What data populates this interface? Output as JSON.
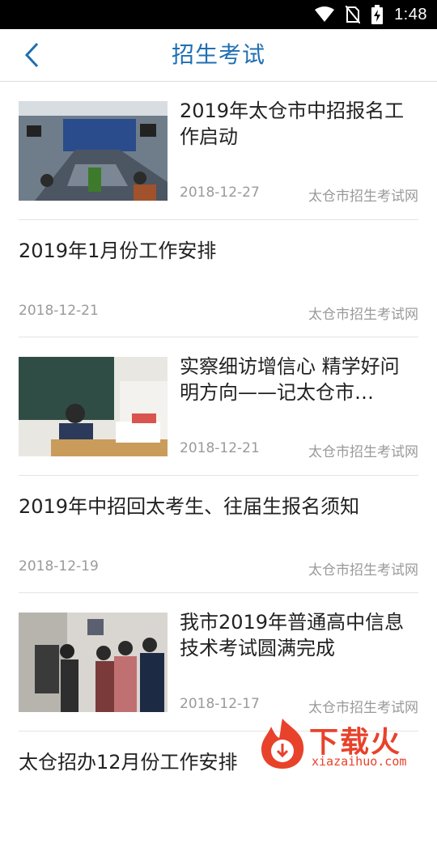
{
  "status_bar": {
    "time": "1:48"
  },
  "header": {
    "title": "招生考试"
  },
  "news": [
    {
      "title": "2019年太仓市中招报名工作启动",
      "date": "2018-12-27",
      "source": "太仓市招生考试网"
    },
    {
      "title": "2019年1月份工作安排",
      "date": "2018-12-21",
      "source": "太仓市招生考试网"
    },
    {
      "title": "实察细访增信心 精学好问明方向——记太仓市…",
      "date": "2018-12-21",
      "source": "太仓市招生考试网"
    },
    {
      "title": "2019年中招回太考生、往届生报名须知",
      "date": "2018-12-19",
      "source": "太仓市招生考试网"
    },
    {
      "title": "我市2019年普通高中信息技术考试圆满完成",
      "date": "2018-12-17",
      "source": "太仓市招生考试网"
    },
    {
      "title": "太仓招办12月份工作安排"
    }
  ],
  "watermark": {
    "text": "下载火",
    "url": "xiazaihuo.com"
  }
}
